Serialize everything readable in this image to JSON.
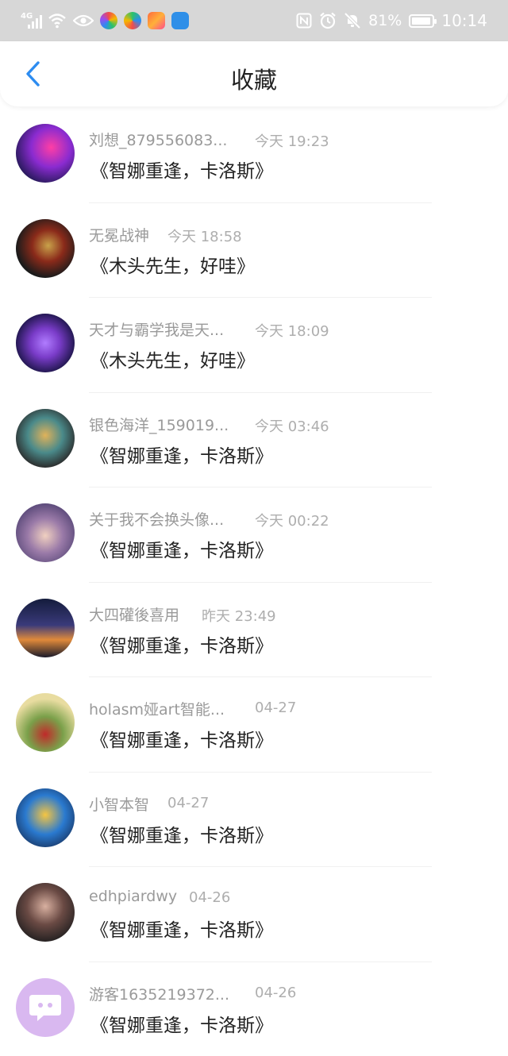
{
  "status_bar": {
    "network": "4G",
    "battery": "81%",
    "battery_level": 0.81,
    "time": "10:14",
    "icons": [
      "signal-icon",
      "wifi-icon",
      "eye-icon",
      "app-icon",
      "nfc-icon",
      "alarm-icon",
      "mute-icon",
      "battery-icon"
    ]
  },
  "nav": {
    "title": "收藏",
    "back_icon": "chevron-left-icon"
  },
  "colors": {
    "accent": "#2d8cf0",
    "status_bar_bg": "#d7d7d7",
    "name_text": "#9a9a9a",
    "title_text": "#222222"
  },
  "items": [
    {
      "name": "刘想_879556083...",
      "time": "今天 19:23",
      "title": "《智娜重逢，卡洛斯》",
      "avatar_colors": [
        "#2a1a5e",
        "#ff3ea5"
      ]
    },
    {
      "name": "无冕战神",
      "time": "今天 18:58",
      "title": "《木头先生，好哇》",
      "avatar_colors": [
        "#1b1b1b",
        "#c9a24a"
      ]
    },
    {
      "name": "天才与霸学我是天...",
      "time": "今天 18:09",
      "title": "《木头先生，好哇》",
      "avatar_colors": [
        "#1a1446",
        "#7a3cc9"
      ]
    },
    {
      "name": "银色海洋_159019...",
      "time": "今天 03:46",
      "title": "《智娜重逢，卡洛斯》",
      "avatar_colors": [
        "#2b2b2b",
        "#e0b25a"
      ]
    },
    {
      "name": "关于我不会换头像...",
      "time": "今天 00:22",
      "title": "《智娜重逢，卡洛斯》",
      "avatar_colors": [
        "#5b4a7a",
        "#f0d0c0"
      ]
    },
    {
      "name": "大四礶後喜用",
      "time": "昨天 23:49",
      "title": "《智娜重逢，卡洛斯》",
      "avatar_colors": [
        "#141c3c",
        "#e08a3a"
      ]
    },
    {
      "name": "holasm娅art智能...",
      "time": "04-27",
      "title": "《智娜重逢，卡洛斯》",
      "avatar_colors": [
        "#e8dca0",
        "#c02a2a"
      ]
    },
    {
      "name": "小智本智",
      "time": "04-27",
      "title": "《智娜重逢，卡洛斯》",
      "avatar_colors": [
        "#2a7ad0",
        "#f5c542"
      ]
    },
    {
      "name": "edhpiardwy",
      "time": "04-26",
      "title": "《智娜重逢，卡洛斯》",
      "avatar_colors": [
        "#2a2424",
        "#b08a7a"
      ]
    },
    {
      "name": "游客1635219372...",
      "time": "04-26",
      "title": "《智娜重逢，卡洛斯》",
      "avatar_colors": [
        "#d9b8f0",
        "#ffffff"
      ]
    }
  ]
}
